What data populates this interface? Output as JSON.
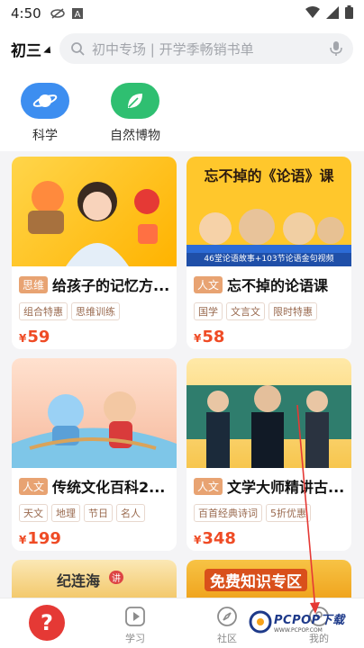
{
  "status_bar": {
    "time": "4:50",
    "icons": [
      "eye-slash-icon",
      "a-badge-icon",
      "wifi-icon",
      "signal-icon",
      "battery-icon"
    ]
  },
  "header": {
    "grade": "初三",
    "search_placeholder": "初中专场 | 开学季畅销书单",
    "icons": [
      "search-icon",
      "microphone-icon"
    ]
  },
  "categories": [
    {
      "label": "科学",
      "icon": "planet-icon",
      "color": "#3d8ef0"
    },
    {
      "label": "自然博物",
      "icon": "leaf-icon",
      "color": "#2fbf71"
    }
  ],
  "courses": [
    {
      "tag": "思维",
      "title": "给孩子的记忆方...",
      "chips": [
        "组合特惠",
        "思维训练"
      ],
      "price": "59",
      "currency": "¥",
      "banner_text": ""
    },
    {
      "tag": "人文",
      "title": "忘不掉的论语课",
      "chips": [
        "国学",
        "文言文",
        "限时特惠"
      ],
      "price": "58",
      "currency": "¥",
      "banner_text": "忘不掉的《论语》课",
      "banner_subtext": "46堂论语故事+103节论语金句视频"
    },
    {
      "tag": "人文",
      "title": "传统文化百科2...",
      "chips": [
        "天文",
        "地理",
        "节日",
        "名人"
      ],
      "price": "199",
      "currency": "¥",
      "banner_text": ""
    },
    {
      "tag": "人文",
      "title": "文学大师精讲古...",
      "chips": [
        "百首经典诗词",
        "5折优惠"
      ],
      "price": "348",
      "currency": "¥",
      "banner_text": ""
    },
    {
      "banner_text": "纪连海",
      "banner_badge": "讲"
    },
    {
      "banner_text": "免费知识专区"
    }
  ],
  "bottom_nav": [
    {
      "label": "",
      "icon": "question-icon"
    },
    {
      "label": "学习",
      "icon": "play-icon"
    },
    {
      "label": "社区",
      "icon": "compass-icon"
    },
    {
      "label": "我的",
      "icon": "profile-icon"
    }
  ],
  "watermark": {
    "brand": "PCPOP下载",
    "sub": "WWW.PCPOP.COM"
  },
  "colors": {
    "price": "#ef4b25",
    "tag": "#e8a372",
    "accent_red": "#e53935"
  }
}
